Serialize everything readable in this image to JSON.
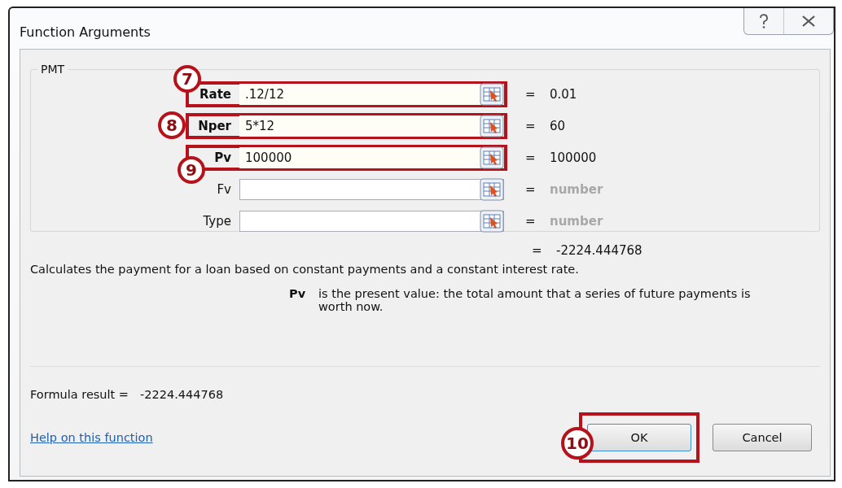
{
  "window": {
    "title": "Function Arguments"
  },
  "function_group": {
    "title": "PMT",
    "arguments": [
      {
        "label": "Rate",
        "value": ".12/12",
        "equals": "=",
        "result": "0.01",
        "result_muted": false,
        "highlighted": true,
        "callout": "7"
      },
      {
        "label": "Nper",
        "value": "5*12",
        "equals": "=",
        "result": "60",
        "result_muted": false,
        "highlighted": true,
        "callout": "8"
      },
      {
        "label": "Pv",
        "value": "100000",
        "equals": "=",
        "result": "100000",
        "result_muted": false,
        "highlighted": true,
        "callout": "9"
      },
      {
        "label": "Fv",
        "equals": "=",
        "result": "number",
        "result_muted": true,
        "highlighted": false
      },
      {
        "label": "Type",
        "equals": "=",
        "result": "number",
        "result_muted": true,
        "highlighted": false
      }
    ]
  },
  "function_result": {
    "equals": "=",
    "value": "-2224.444768"
  },
  "description": "Calculates the payment for a loan based on constant payments and a constant interest rate.",
  "argument_help": {
    "name": "Pv",
    "text": "is the present value: the total amount that a series of future payments is worth now."
  },
  "formula_result": {
    "label": "Formula result =",
    "value": "-2224.444768"
  },
  "help_link": "Help on this function",
  "buttons": [
    {
      "label": "OK",
      "highlighted": true,
      "callout": "10"
    },
    {
      "label": "Cancel",
      "highlighted": false
    }
  ]
}
